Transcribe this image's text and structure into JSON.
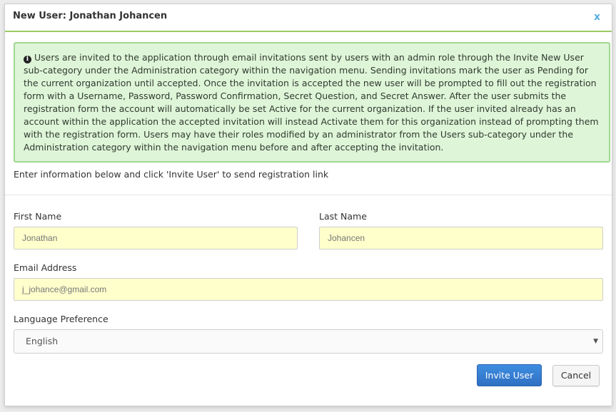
{
  "modal": {
    "title": "New User: Jonathan Johancen",
    "close_label": "x"
  },
  "alert": {
    "icon": "info-circle-icon",
    "text": "Users are invited to the application through email invitations sent by users with an admin role through the Invite New User sub-category under the Administration category within the navigation menu. Sending invitations mark the user as Pending for the current organization until accepted. Once the invitation is accepted the new user will be prompted to fill out the registration form with a Username, Password, Password Confirmation, Secret Question, and Secret Answer. After the user submits the registration form the account will automatically be set Active for the current organization. If the user invited already has an account within the application the accepted invitation will instead Activate them for this organization instead of prompting them with the registration form. Users may have their roles modified by an administrator from the Users sub-category under the Administration category within the navigation menu before and after accepting the invitation."
  },
  "intro_text": "Enter information below and click 'Invite User' to send registration link",
  "form": {
    "first_name": {
      "label": "First Name",
      "value": "Jonathan"
    },
    "last_name": {
      "label": "Last Name",
      "value": "Johancen"
    },
    "email": {
      "label": "Email Address",
      "value": "j_johance@gmail.com"
    },
    "language": {
      "label": "Language Preference",
      "selected": "English"
    }
  },
  "buttons": {
    "invite_label": "Invite User",
    "cancel_label": "Cancel"
  },
  "colors": {
    "accent_green": "#9ccc65",
    "alert_background": "#dff5d8",
    "input_background": "#ffffcc",
    "primary_button": "#2f6fc4",
    "close_blue": "#5aaee0"
  }
}
